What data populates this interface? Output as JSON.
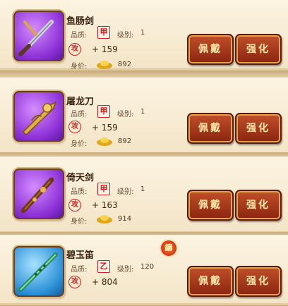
{
  "labels": {
    "quality": "品质:",
    "level": "级别:",
    "price": "身价:"
  },
  "buttons": {
    "equip": "佩戴",
    "enhance": "强化"
  },
  "items": [
    {
      "name": "鱼肠剑",
      "grade": "甲",
      "level": "1",
      "attack": "+ 159",
      "price": "892",
      "icon": "sword-icon",
      "bg": "purple"
    },
    {
      "name": "屠龙刀",
      "grade": "甲",
      "level": "1",
      "attack": "+ 159",
      "price": "892",
      "icon": "dragon-blade-icon",
      "bg": "purple"
    },
    {
      "name": "倚天剑",
      "grade": "甲",
      "level": "1",
      "attack": "+ 163",
      "price": "914",
      "icon": "heaven-sword-icon",
      "bg": "purple"
    },
    {
      "name": "碧玉笛",
      "grade": "乙",
      "level": "120",
      "attack": "+ 804",
      "price": "",
      "icon": "jade-flute-icon",
      "bg": "blue",
      "badge": "鑄"
    }
  ],
  "stat_glyph": "攻",
  "colors": {
    "grade_red": "#d11111",
    "button_top": "#c0502a",
    "button_bottom": "#8a2410",
    "card_bg": "#fcf4e2"
  }
}
